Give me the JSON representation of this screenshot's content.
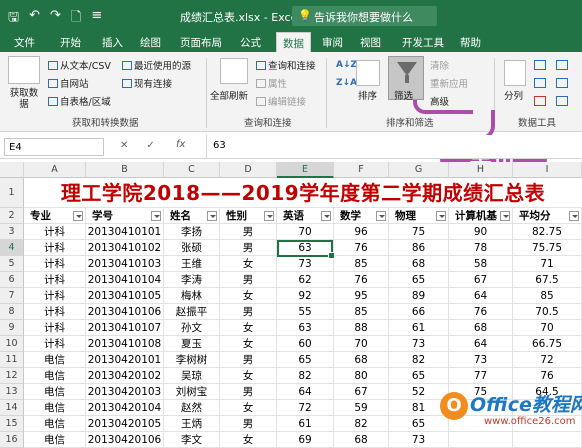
{
  "titlebar": {
    "qat_save": "🖫",
    "qat_undo": "↶",
    "qat_redo": "↷",
    "qat_new": "🗋",
    "qat_more": "≡",
    "doc_title": "成绩汇总表.xlsx - Excel",
    "search_placeholder": "告诉我你想要做什么",
    "search_icon": "💡"
  },
  "tabs": [
    "文件",
    "开始",
    "插入",
    "绘图",
    "页面布局",
    "公式",
    "数据",
    "审阅",
    "视图",
    "开发工具",
    "帮助"
  ],
  "active_tab": "数据",
  "ribbon": {
    "get_data": "获取数据",
    "from_text": "从文本/CSV",
    "from_web": "自网站",
    "from_table": "自表格/区域",
    "recent_sources": "最近使用的源",
    "existing_conn": "现有连接",
    "group1": "获取和转换数据",
    "refresh_all": "全部刷新",
    "queries_conn": "查询和连接",
    "properties": "属性",
    "edit_links": "编辑链接",
    "group2": "查询和连接",
    "sort_az": "A↓Z",
    "sort_za": "Z↓A",
    "sort": "排序",
    "filter": "筛选",
    "clear": "清除",
    "reapply": "重新应用",
    "advanced": "高级",
    "group3": "排序和筛选",
    "split": "分列",
    "group4": "数据工具"
  },
  "callout": "单击",
  "formula_bar": {
    "name_box": "E4",
    "cancel": "✕",
    "enter": "✓",
    "fx": "fx",
    "value": "63"
  },
  "sheet": {
    "columns": [
      "A",
      "B",
      "C",
      "D",
      "E",
      "F",
      "G",
      "H",
      "I"
    ],
    "title": "理工学院2018——2019学年度第二学期成绩汇总表",
    "headers": [
      "专业",
      "学号",
      "姓名",
      "性别",
      "英语",
      "数学",
      "物理",
      "计算机基",
      "平均分"
    ],
    "rows": [
      [
        "计科",
        "20130410101",
        "李扬",
        "男",
        "70",
        "96",
        "75",
        "90",
        "82.75"
      ],
      [
        "计科",
        "20130410102",
        "张硕",
        "男",
        "63",
        "76",
        "86",
        "78",
        "75.75"
      ],
      [
        "计科",
        "20130410103",
        "王维",
        "女",
        "73",
        "85",
        "68",
        "58",
        "71"
      ],
      [
        "计科",
        "20130410104",
        "李涛",
        "男",
        "62",
        "76",
        "65",
        "67",
        "67.5"
      ],
      [
        "计科",
        "20130410105",
        "梅林",
        "女",
        "92",
        "95",
        "89",
        "64",
        "85"
      ],
      [
        "计科",
        "20130410106",
        "赵振平",
        "男",
        "55",
        "85",
        "66",
        "76",
        "70.5"
      ],
      [
        "计科",
        "20130410107",
        "孙文",
        "女",
        "63",
        "88",
        "61",
        "68",
        "70"
      ],
      [
        "计科",
        "20130410108",
        "夏玉",
        "女",
        "60",
        "70",
        "73",
        "64",
        "66.75"
      ],
      [
        "电信",
        "20130420101",
        "李树树",
        "男",
        "65",
        "68",
        "82",
        "73",
        "72"
      ],
      [
        "电信",
        "20130420102",
        "吴琼",
        "女",
        "82",
        "80",
        "65",
        "77",
        "76"
      ],
      [
        "电信",
        "20130420103",
        "刘树宝",
        "男",
        "64",
        "67",
        "52",
        "75",
        "64.5"
      ],
      [
        "电信",
        "20130420104",
        "赵然",
        "女",
        "72",
        "59",
        "81",
        "",
        ""
      ],
      [
        "电信",
        "20130420105",
        "王炳",
        "男",
        "61",
        "82",
        "65",
        "",
        ""
      ],
      [
        "电信",
        "20130420106",
        "李文",
        "女",
        "69",
        "68",
        "73",
        "",
        ""
      ]
    ]
  },
  "watermark": {
    "brand": "Office教程网",
    "url": "www.office26.com"
  }
}
